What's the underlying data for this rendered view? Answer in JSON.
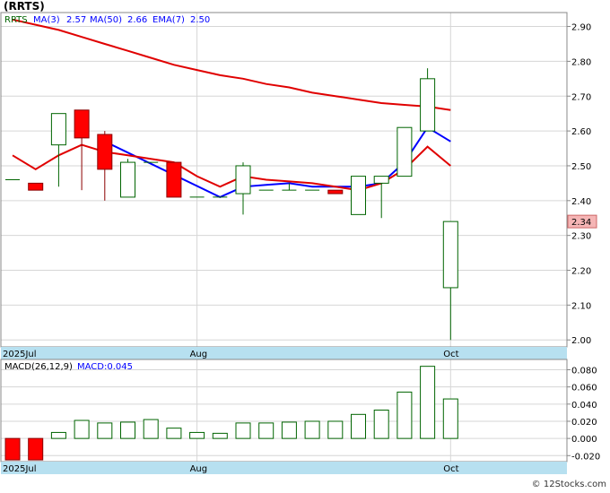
{
  "title": "(RRTS)",
  "watermark": "© 12Stocks.com",
  "colors": {
    "up_fill": "#ffffff",
    "up_stroke": "#006400",
    "down_fill": "#ff0000",
    "down_stroke": "#8b0000",
    "ma_fast": "#0000ff",
    "ma_slow": "#e00000",
    "grid": "#d6d6d6",
    "axis_band": "#b7e0f0",
    "last_price_bg": "#f5b5b5",
    "macd_bar_up": "#006400",
    "macd_bar_down": "#ff0000"
  },
  "chart_data": [
    {
      "type": "candlestick",
      "legend": {
        "ticker": "RRTS",
        "items": [
          {
            "label": "MA(3)",
            "value": "2.57",
            "color": "#0000ff"
          },
          {
            "label": "MA(50)",
            "value": "2.66",
            "color": "#e00000"
          },
          {
            "label": "EMA(7)",
            "value": "2.50",
            "color": "#e00000"
          }
        ]
      },
      "ylim": [
        1.98,
        2.94
      ],
      "y_ticks": [
        2.0,
        2.1,
        2.2,
        2.3,
        2.4,
        2.5,
        2.6,
        2.7,
        2.8,
        2.9
      ],
      "y_tick_labels": [
        "2.00",
        "2.10",
        "2.20",
        "2.30",
        "2.40",
        "2.50",
        "2.60",
        "2.70",
        "2.80",
        "2.90"
      ],
      "x_labels": [
        {
          "index": 0,
          "text": "2025Jul"
        },
        {
          "index": 8,
          "text": "Aug"
        },
        {
          "index": 19,
          "text": "Oct"
        }
      ],
      "vertical_lines_at_index": [
        8,
        19
      ],
      "last_price": "2.34",
      "candles": [
        {
          "o": 2.46,
          "h": 2.46,
          "l": 2.46,
          "c": 2.46
        },
        {
          "o": 2.45,
          "h": 2.45,
          "l": 2.43,
          "c": 2.43
        },
        {
          "o": 2.56,
          "h": 2.65,
          "l": 2.44,
          "c": 2.65
        },
        {
          "o": 2.66,
          "h": 2.66,
          "l": 2.43,
          "c": 2.58
        },
        {
          "o": 2.59,
          "h": 2.6,
          "l": 2.4,
          "c": 2.49
        },
        {
          "o": 2.41,
          "h": 2.52,
          "l": 2.41,
          "c": 2.51
        },
        {
          "o": 2.51,
          "h": 2.51,
          "l": 2.51,
          "c": 2.51
        },
        {
          "o": 2.51,
          "h": 2.51,
          "l": 2.41,
          "c": 2.41
        },
        {
          "o": 2.41,
          "h": 2.41,
          "l": 2.41,
          "c": 2.41
        },
        {
          "o": 2.41,
          "h": 2.41,
          "l": 2.41,
          "c": 2.41
        },
        {
          "o": 2.42,
          "h": 2.51,
          "l": 2.36,
          "c": 2.5
        },
        {
          "o": 2.43,
          "h": 2.43,
          "l": 2.43,
          "c": 2.43
        },
        {
          "o": 2.43,
          "h": 2.45,
          "l": 2.43,
          "c": 2.43
        },
        {
          "o": 2.43,
          "h": 2.43,
          "l": 2.43,
          "c": 2.43
        },
        {
          "o": 2.43,
          "h": 2.43,
          "l": 2.42,
          "c": 2.42
        },
        {
          "o": 2.36,
          "h": 2.47,
          "l": 2.36,
          "c": 2.47
        },
        {
          "o": 2.45,
          "h": 2.47,
          "l": 2.35,
          "c": 2.47
        },
        {
          "o": 2.47,
          "h": 2.61,
          "l": 2.47,
          "c": 2.61
        },
        {
          "o": 2.6,
          "h": 2.78,
          "l": 2.6,
          "c": 2.75
        },
        {
          "o": 2.15,
          "h": 2.34,
          "l": 2.0,
          "c": 2.34
        }
      ],
      "series": [
        {
          "name": "MA(3)",
          "color": "#0000ff",
          "values": [
            null,
            null,
            null,
            null,
            2.57,
            null,
            null,
            null,
            null,
            2.41,
            2.44,
            2.445,
            2.45,
            2.44,
            2.44,
            2.44,
            2.45,
            2.51,
            2.61,
            2.57
          ]
        },
        {
          "name": "EMA(7)",
          "color": "#e00000",
          "values": [
            2.53,
            2.49,
            2.53,
            2.56,
            2.54,
            2.53,
            2.52,
            2.51,
            2.47,
            2.44,
            2.47,
            2.46,
            2.455,
            2.45,
            2.44,
            2.43,
            2.45,
            2.49,
            2.555,
            2.5
          ]
        },
        {
          "name": "MA(50)",
          "color": "#e00000",
          "values": [
            2.92,
            2.905,
            2.89,
            2.87,
            2.85,
            2.83,
            2.81,
            2.79,
            2.775,
            2.76,
            2.75,
            2.735,
            2.725,
            2.71,
            2.7,
            2.69,
            2.68,
            2.675,
            2.67,
            2.66
          ]
        }
      ]
    },
    {
      "type": "bar",
      "legend": {
        "label": "MACD(26,12,9)",
        "value_label": "MACD:0.045"
      },
      "ylim": [
        -0.027,
        0.092
      ],
      "y_ticks": [
        -0.02,
        0.0,
        0.02,
        0.04,
        0.06,
        0.08
      ],
      "y_tick_labels": [
        "-0.020",
        "0.000",
        "0.020",
        "0.040",
        "0.060",
        "0.080"
      ],
      "x_labels": [
        {
          "index": 0,
          "text": "2025Jul"
        },
        {
          "index": 8,
          "text": "Aug"
        },
        {
          "index": 19,
          "text": "Oct"
        }
      ],
      "values": [
        -0.025,
        -0.025,
        0.007,
        0.021,
        0.018,
        0.019,
        0.022,
        0.012,
        0.007,
        0.006,
        0.018,
        0.018,
        0.019,
        0.02,
        0.02,
        0.028,
        0.033,
        0.054,
        0.084,
        0.046
      ]
    }
  ]
}
